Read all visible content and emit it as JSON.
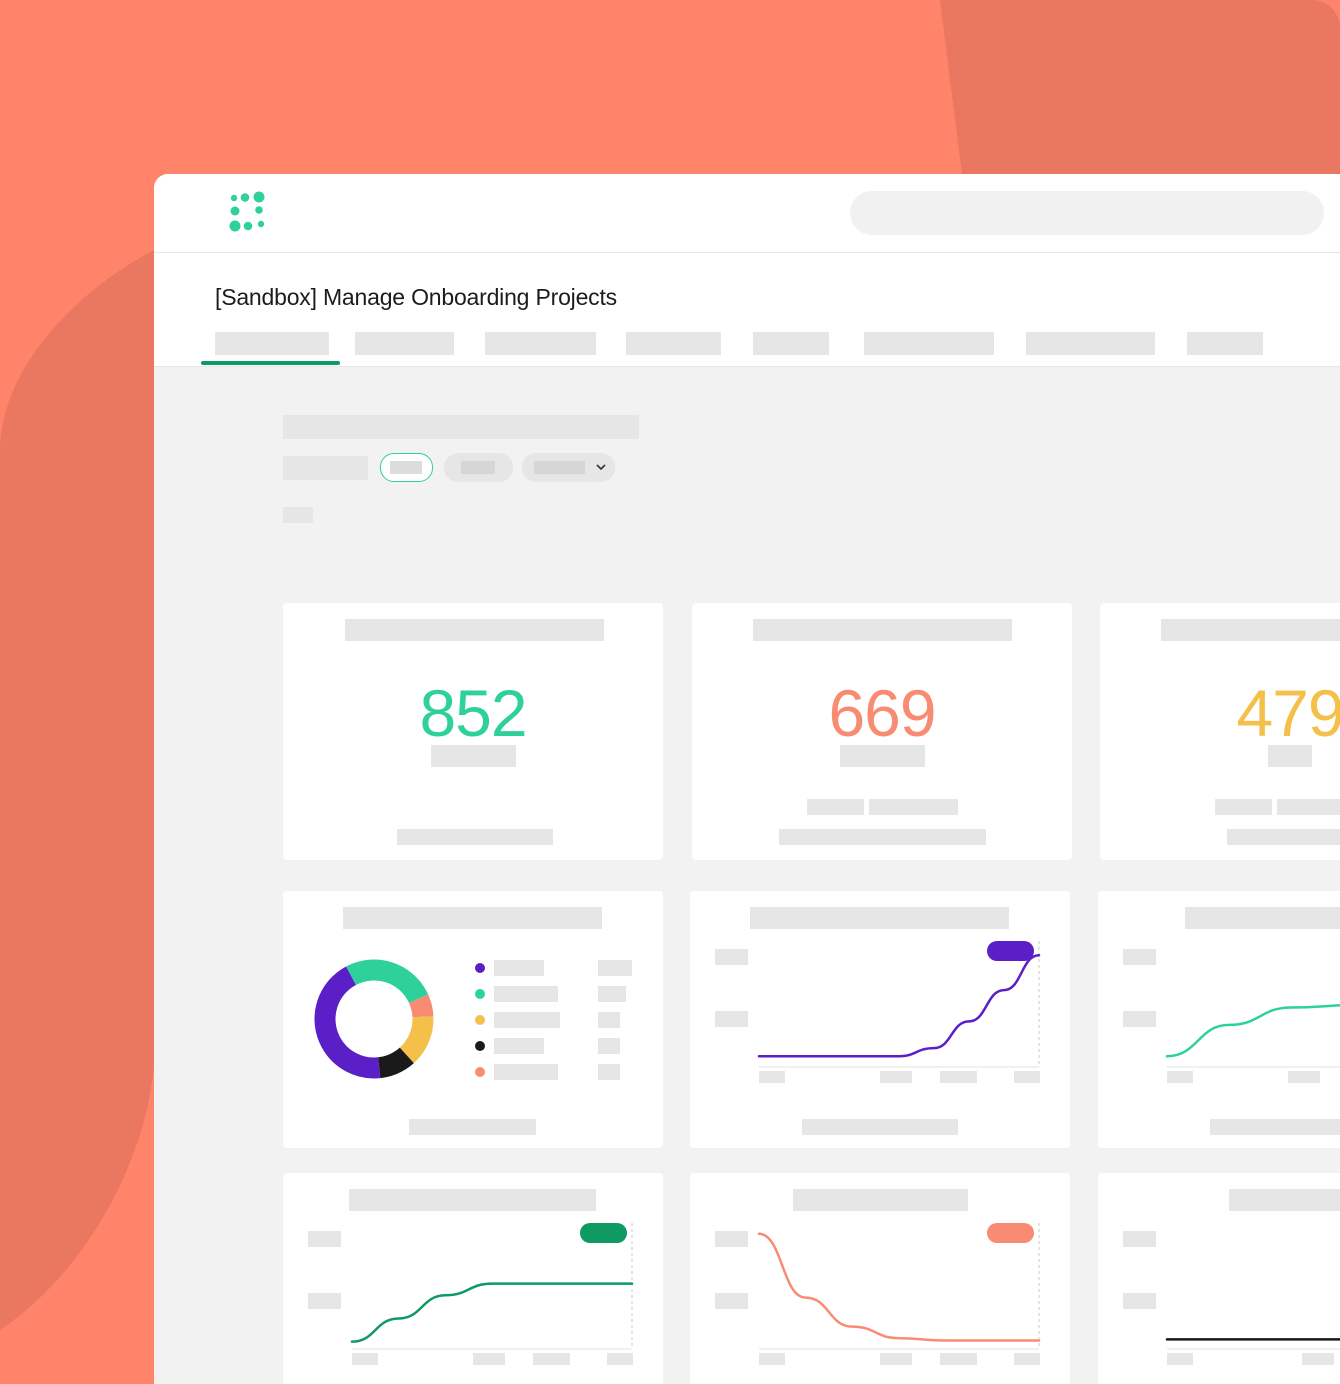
{
  "app": {
    "page_title": "[Sandbox] Manage Onboarding Projects"
  },
  "colors": {
    "background": "#ff8469",
    "background_shape": "#ea7760",
    "brand_green": "#0e9a62",
    "teal": "#2fd19b",
    "coral": "#f98b72",
    "yellow": "#f5c04a",
    "purple": "#5a1fc6",
    "black": "#1a1a1a"
  },
  "icons": {
    "logo": "dot-grid-logo-icon",
    "filter_dropdown": "chevron-down-icon"
  },
  "tabs": {
    "count": 8,
    "active_index": 0
  },
  "kpis": [
    {
      "value": "852",
      "color": "#2fd19b"
    },
    {
      "value": "669",
      "color": "#f98b72"
    },
    {
      "value": "479",
      "color": "#f5c04a"
    }
  ],
  "chart_data": [
    {
      "type": "pie",
      "variant": "donut",
      "slices": [
        {
          "color": "#2fd19b",
          "value": 0.26
        },
        {
          "color": "#f98b72",
          "value": 0.06
        },
        {
          "color": "#f5c04a",
          "value": 0.14
        },
        {
          "color": "#1a1a1a",
          "value": 0.1
        },
        {
          "color": "#5a1fc6",
          "value": 0.44
        }
      ],
      "legend_colors": [
        "#5a1fc6",
        "#2fd19b",
        "#f5c04a",
        "#1a1a1a",
        "#f98b72"
      ]
    },
    {
      "type": "line",
      "series": [
        {
          "color": "#5a1fc6",
          "values": [
            0.05,
            0.05,
            0.05,
            0.05,
            0.05,
            0.12,
            0.35,
            0.62,
            0.92
          ]
        }
      ],
      "badge_color": "#5a1fc6"
    },
    {
      "type": "line",
      "series": [
        {
          "color": "#2fd19b",
          "values": [
            0.05,
            0.32,
            0.47,
            0.49,
            0.38,
            0.36
          ]
        }
      ]
    },
    {
      "type": "line",
      "series": [
        {
          "color": "#0e9a62",
          "values": [
            0.02,
            0.22,
            0.42,
            0.52,
            0.52,
            0.52,
            0.52
          ]
        }
      ],
      "badge_color": "#0e9a62"
    },
    {
      "type": "line",
      "series": [
        {
          "color": "#f98b72",
          "values": [
            0.95,
            0.4,
            0.15,
            0.05,
            0.03,
            0.03,
            0.03
          ]
        }
      ],
      "badge_color": "#f98b72"
    },
    {
      "type": "line",
      "series": [
        {
          "color": "#1a1a1a",
          "values": [
            0.04,
            0.04,
            0.04,
            0.04,
            0.06
          ]
        }
      ]
    }
  ]
}
